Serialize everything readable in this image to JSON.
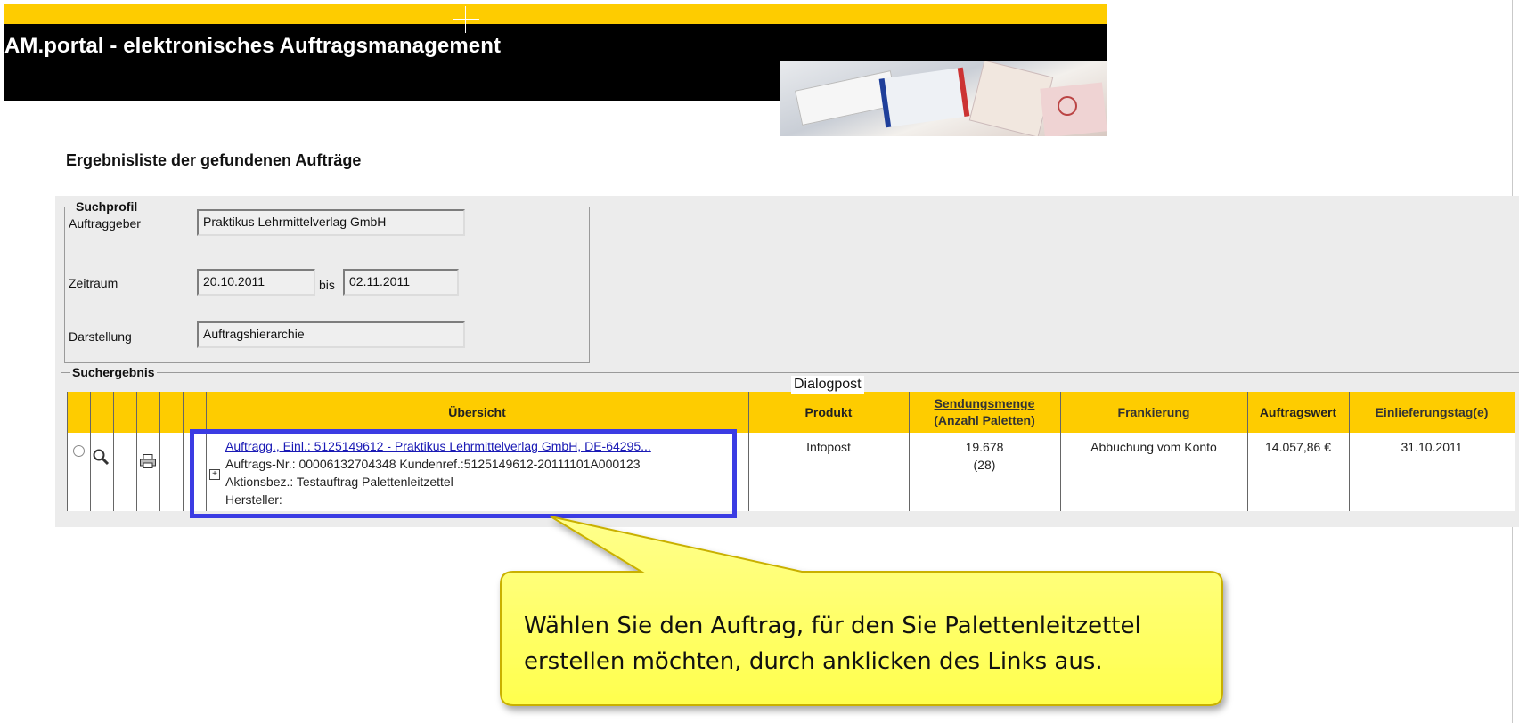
{
  "header": {
    "title": "AM.portal - elektronisches Auftragsmanagement"
  },
  "page": {
    "heading": "Ergebnisliste der gefundenen Aufträge"
  },
  "suchprofil": {
    "legend": "Suchprofil",
    "auftraggeber_label": "Auftraggeber",
    "auftraggeber_value": "Praktikus Lehrmittelverlag GmbH",
    "zeitraum_label": "Zeitraum",
    "zeitraum_from": "20.10.2011",
    "bis_label": "bis",
    "zeitraum_to": "02.11.2011",
    "darstellung_label": "Darstellung",
    "darstellung_value": "Auftragshierarchie"
  },
  "suchergebnis": {
    "legend": "Suchergebnis",
    "group_label": "Dialogpost",
    "columns": {
      "uebersicht": "Übersicht",
      "produkt": "Produkt",
      "sendungsmenge_line1": "Sendungsmenge",
      "sendungsmenge_line2": "(Anzahl Paletten)",
      "frankierung": "Frankierung",
      "auftragswert": "Auftragswert",
      "einlieferungstag": "Einlieferungstag(e)"
    },
    "rows": [
      {
        "link": "Auftragg., Einl.: 5125149612 - Praktikus Lehrmittelverlag GmbH, DE-64295...",
        "auftrags_nr": "Auftrags-Nr.: 00006132704348 Kundenref.:5125149612-20111101A000123",
        "aktionsbez": "Aktionsbez.: Testauftrag Palettenleitzettel",
        "hersteller": "Hersteller:",
        "produkt": "Infopost",
        "sendungsmenge": "19.678",
        "paletten": "(28)",
        "frankierung": "Abbuchung vom Konto",
        "auftragswert": "14.057,86 €",
        "einlieferungstag": "31.10.2011"
      }
    ]
  },
  "callout": {
    "line1": "Wählen Sie den Auftrag, für den Sie Palettenleitzettel",
    "line2": "erstellen möchten, durch anklicken des Links aus."
  },
  "colors": {
    "brand_yellow": "#fecc00",
    "highlight_blue": "#3b3ce3",
    "callout_yellow": "#ffff66",
    "link_blue": "#1a1ab5"
  },
  "icons": {
    "select": "radio-button",
    "view": "magnifier-icon",
    "print": "printer-icon",
    "expand": "plus-box-icon"
  }
}
